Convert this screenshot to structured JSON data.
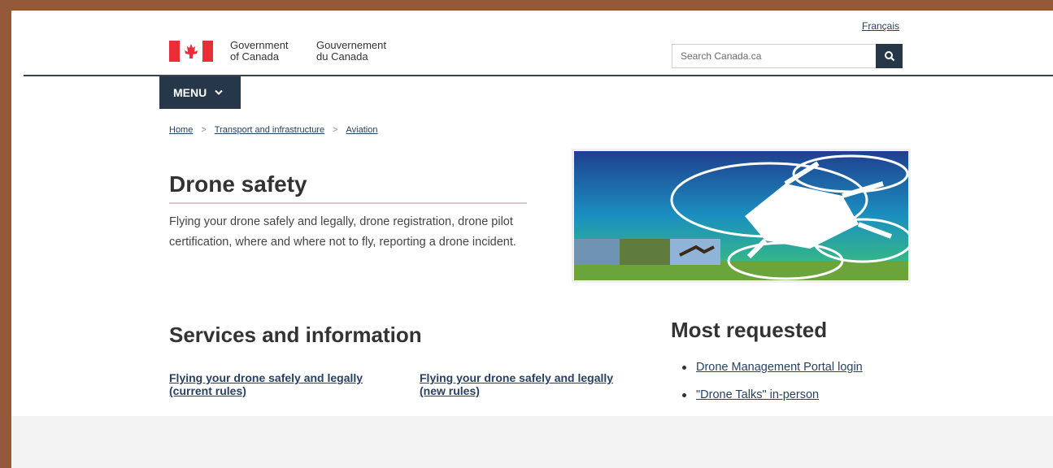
{
  "header": {
    "language_toggle": "Français",
    "signature_en_line1": "Government",
    "signature_en_line2": "of Canada",
    "signature_fr_line1": "Gouvernement",
    "signature_fr_line2": "du Canada",
    "search_placeholder": "Search Canada.ca",
    "search_icon": "search-icon",
    "flag_icon": "canada-flag-icon",
    "menu_label": "MENU",
    "menu_icon": "chevron-down-icon"
  },
  "breadcrumbs": [
    "Home",
    "Transport and infrastructure",
    "Aviation"
  ],
  "breadcrumb_separator": ">",
  "main": {
    "title": "Drone safety",
    "description": "Flying your drone safely and legally, drone registration, drone pilot certification, where and where not to fly, reporting a drone incident.",
    "hero_image_icon": "drone-banner-image"
  },
  "services": {
    "heading": "Services and information",
    "links": [
      {
        "line1": "Flying your drone safely and legally",
        "line2": "(current rules)"
      },
      {
        "line1": "Flying your drone safely and legally",
        "line2": "(new rules)"
      }
    ]
  },
  "most_requested": {
    "heading": "Most requested",
    "items": [
      "Drone Management Portal login",
      "\"Drone Talks\" in-person"
    ]
  },
  "colors": {
    "brand_dark": "#26374a",
    "link": "#284162",
    "flag_red": "#eb2d37",
    "backdrop": "#94583a"
  }
}
